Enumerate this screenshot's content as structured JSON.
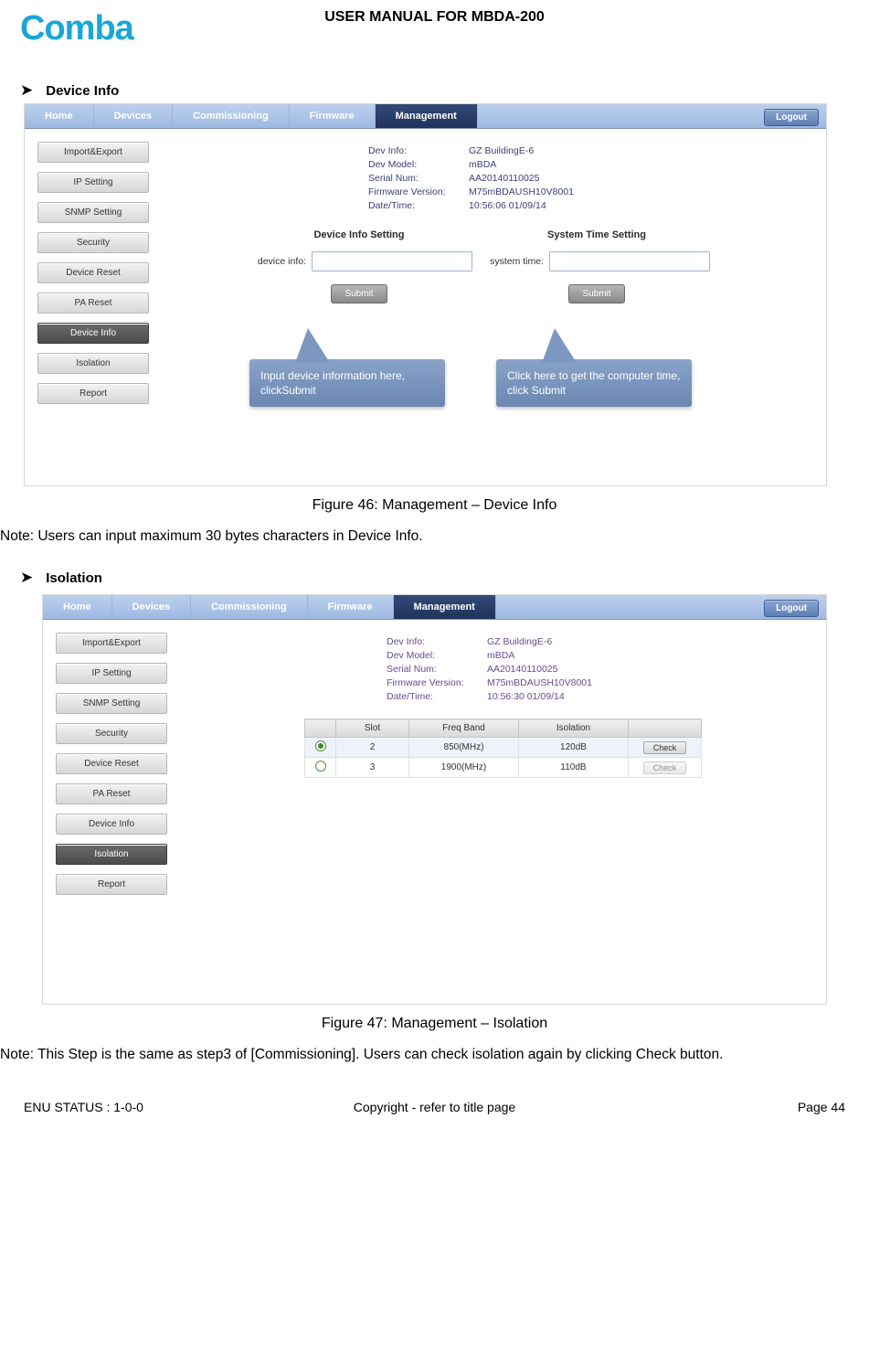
{
  "doc": {
    "logo_text": "Comba",
    "title": "USER MANUAL FOR MBDA-200",
    "sections": {
      "device_info_heading": "Device Info",
      "isolation_heading": "Isolation"
    },
    "captions": {
      "fig46": "Figure 46: Management – Device Info",
      "fig47": "Figure 47: Management – Isolation"
    },
    "notes": {
      "n1": "Note: Users can input maximum 30 bytes characters in Device Info.",
      "n2": "Note: This Step is the same as step3 of [Commissioning]. Users can check isolation again by clicking Check button."
    },
    "footer": {
      "left": "ENU STATUS : 1-0-0",
      "center": "Copyright - refer to title page",
      "right": "Page 44"
    }
  },
  "nav": {
    "tabs": [
      "Home",
      "Devices",
      "Commissioning",
      "Firmware",
      "Management"
    ],
    "active": "Management",
    "logout": "Logout"
  },
  "sidebar": {
    "items": [
      "Import&Export",
      "IP Setting",
      "SNMP Setting",
      "Security",
      "Device Reset",
      "PA Reset",
      "Device Info",
      "Isolation",
      "Report"
    ]
  },
  "fig46": {
    "active_side": "Device Info",
    "kv": [
      {
        "k": "Dev Info:",
        "v": "GZ BuildingE-6"
      },
      {
        "k": "Dev Model:",
        "v": "mBDA"
      },
      {
        "k": "Serial Num:",
        "v": "AA20140110025"
      },
      {
        "k": "Firmware Version:",
        "v": "M75mBDAUSH10V8001"
      },
      {
        "k": "Date/Time:",
        "v": "10:56:06 01/09/14"
      }
    ],
    "sec1": "Device Info Setting",
    "sec2": "System Time Setting",
    "label1": "device info:",
    "label2": "system time:",
    "submit": "Submit",
    "callout1": "Input device information here, clickSubmit",
    "callout2": "Click here to get the computer time, click Submit"
  },
  "fig47": {
    "active_side": "Isolation",
    "kv": [
      {
        "k": "Dev Info:",
        "v": "GZ BuildingE-6"
      },
      {
        "k": "Dev Model:",
        "v": "mBDA"
      },
      {
        "k": "Serial Num:",
        "v": "AA20140110025"
      },
      {
        "k": "Firmware Version:",
        "v": "M75mBDAUSH10V8001"
      },
      {
        "k": "Date/Time:",
        "v": "10:56:30 01/09/14"
      }
    ],
    "table": {
      "headers": [
        "",
        "Slot",
        "Freq Band",
        "Isolation",
        ""
      ],
      "rows": [
        {
          "sel": true,
          "slot": "2",
          "band": "850(MHz)",
          "iso": "120dB",
          "check": "Check",
          "enabled": true
        },
        {
          "sel": false,
          "slot": "3",
          "band": "1900(MHz)",
          "iso": "110dB",
          "check": "Check",
          "enabled": false
        }
      ]
    }
  }
}
